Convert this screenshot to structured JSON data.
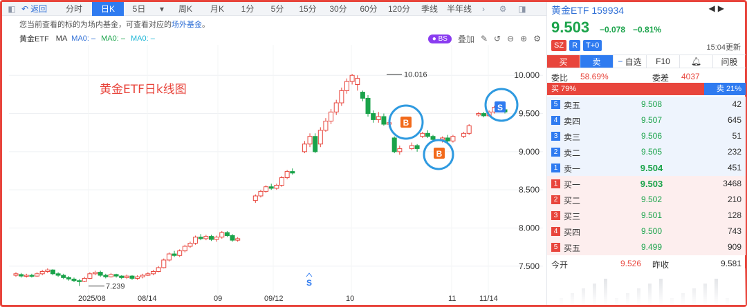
{
  "toolbar": {
    "back": "返回",
    "periods": [
      "分时",
      "日K",
      "5日",
      "周K",
      "月K",
      "1分",
      "5分",
      "15分",
      "30分",
      "60分",
      "120分",
      "季线",
      "半年线"
    ],
    "active": "日K"
  },
  "notice": {
    "text": "您当前查看的标的为场内基金，可查看对应的",
    "link": "场外基金",
    "end": "。"
  },
  "ma_bar": {
    "code": "黄金ETF",
    "ma": "MA",
    "ma0_1": "MA0: –",
    "ma0_2": "MA0: –",
    "ma0_3": "MA0: –",
    "bs": "BS",
    "overlay": "叠加"
  },
  "chart_data": {
    "type": "candlestick",
    "title": "黄金ETF日k线图",
    "y_ticks": [
      "10.000",
      "9.500",
      "9.000",
      "8.500",
      "8.000",
      "7.500"
    ],
    "ylim": [
      7.1,
      10.4
    ],
    "x_ticks": [
      "2025/08",
      "08/14",
      "09",
      "09/12",
      "10",
      "11",
      "11/14"
    ],
    "annotations": {
      "high": "10.016",
      "low": "7.239"
    },
    "markers": [
      "B",
      "B",
      "S",
      "S"
    ],
    "candles": [
      [
        7.38,
        7.4,
        7.36,
        7.42
      ],
      [
        7.39,
        7.37,
        7.35,
        7.41
      ],
      [
        7.37,
        7.38,
        7.35,
        7.4
      ],
      [
        7.38,
        7.37,
        7.35,
        7.4
      ],
      [
        7.37,
        7.4,
        7.36,
        7.42
      ],
      [
        7.4,
        7.43,
        7.38,
        7.45
      ],
      [
        7.43,
        7.45,
        7.41,
        7.47
      ],
      [
        7.45,
        7.4,
        7.38,
        7.46
      ],
      [
        7.4,
        7.38,
        7.36,
        7.42
      ],
      [
        7.38,
        7.35,
        7.33,
        7.4
      ],
      [
        7.35,
        7.33,
        7.31,
        7.37
      ],
      [
        7.33,
        7.31,
        7.29,
        7.35
      ],
      [
        7.31,
        7.3,
        7.24,
        7.33
      ],
      [
        7.3,
        7.34,
        7.29,
        7.36
      ],
      [
        7.34,
        7.4,
        7.33,
        7.42
      ],
      [
        7.4,
        7.42,
        7.38,
        7.44
      ],
      [
        7.42,
        7.38,
        7.36,
        7.44
      ],
      [
        7.38,
        7.36,
        7.34,
        7.4
      ],
      [
        7.36,
        7.39,
        7.35,
        7.41
      ],
      [
        7.39,
        7.37,
        7.35,
        7.4
      ],
      [
        7.37,
        7.35,
        7.33,
        7.38
      ],
      [
        7.35,
        7.37,
        7.33,
        7.39
      ],
      [
        7.37,
        7.34,
        7.32,
        7.38
      ],
      [
        7.34,
        7.36,
        7.32,
        7.38
      ],
      [
        7.36,
        7.38,
        7.34,
        7.4
      ],
      [
        7.38,
        7.4,
        7.37,
        7.42
      ],
      [
        7.4,
        7.43,
        7.38,
        7.45
      ],
      [
        7.43,
        7.48,
        7.42,
        7.5
      ],
      [
        7.48,
        7.58,
        7.47,
        7.6
      ],
      [
        7.58,
        7.66,
        7.56,
        7.68
      ],
      [
        7.66,
        7.64,
        7.62,
        7.7
      ],
      [
        7.64,
        7.7,
        7.62,
        7.72
      ],
      [
        7.7,
        7.76,
        7.68,
        7.78
      ],
      [
        7.76,
        7.8,
        7.74,
        7.82
      ],
      [
        7.8,
        7.88,
        7.78,
        7.9
      ],
      [
        7.88,
        7.86,
        7.84,
        7.92
      ],
      [
        7.86,
        7.89,
        7.84,
        7.91
      ],
      [
        7.89,
        7.85,
        7.83,
        7.91
      ],
      [
        7.85,
        7.88,
        7.82,
        7.9
      ],
      [
        7.88,
        7.94,
        7.86,
        7.96
      ],
      [
        7.94,
        7.9,
        7.88,
        7.96
      ],
      [
        7.9,
        7.84,
        7.82,
        7.92
      ],
      [
        7.84,
        7.86,
        7.82,
        7.88
      ],
      [
        8.36,
        8.42,
        8.33,
        8.44
      ],
      [
        8.42,
        8.48,
        8.4,
        8.5
      ],
      [
        8.48,
        8.54,
        8.46,
        8.56
      ],
      [
        8.54,
        8.52,
        8.5,
        8.58
      ],
      [
        8.52,
        8.56,
        8.5,
        8.58
      ],
      [
        8.56,
        8.66,
        8.54,
        8.68
      ],
      [
        8.66,
        8.74,
        8.64,
        8.76
      ],
      [
        8.74,
        8.72,
        8.7,
        8.78
      ],
      [
        9.0,
        9.1,
        8.98,
        9.14
      ],
      [
        9.1,
        9.2,
        9.06,
        9.24
      ],
      [
        9.2,
        9.0,
        8.98,
        9.24
      ],
      [
        9.1,
        9.28,
        9.06,
        9.32
      ],
      [
        9.28,
        9.4,
        9.26,
        9.44
      ],
      [
        9.4,
        9.52,
        9.36,
        9.56
      ],
      [
        9.52,
        9.64,
        9.48,
        9.68
      ],
      [
        9.64,
        9.8,
        9.6,
        9.84
      ],
      [
        9.8,
        9.92,
        9.76,
        9.96
      ],
      [
        9.92,
        10.0,
        9.88,
        10.02
      ],
      [
        9.88,
        9.96,
        9.8,
        10.0
      ],
      [
        9.78,
        9.7,
        9.66,
        9.8
      ],
      [
        9.7,
        9.5,
        9.46,
        9.74
      ],
      [
        9.5,
        9.42,
        9.38,
        9.54
      ],
      [
        9.42,
        9.46,
        9.38,
        9.52
      ],
      [
        9.46,
        9.36,
        9.34,
        9.5
      ],
      [
        9.36,
        9.38,
        9.32,
        9.42
      ],
      [
        9.18,
        9.0,
        8.98,
        9.2
      ],
      [
        9.0,
        9.04,
        8.96,
        9.08
      ],
      [
        9.04,
        9.08,
        9.02,
        9.12
      ],
      [
        9.08,
        9.04,
        9.0,
        9.1
      ],
      [
        9.2,
        9.24,
        9.18,
        9.26
      ],
      [
        9.24,
        9.2,
        9.18,
        9.28
      ],
      [
        9.2,
        9.16,
        9.14,
        9.22
      ],
      [
        9.16,
        9.18,
        9.12,
        9.2
      ],
      [
        9.18,
        9.14,
        9.12,
        9.22
      ],
      [
        9.14,
        9.2,
        9.12,
        9.22
      ],
      [
        9.2,
        9.24,
        9.18,
        9.26
      ],
      [
        9.24,
        9.34,
        9.22,
        9.36
      ],
      [
        9.48,
        9.5,
        9.46,
        9.52
      ],
      [
        9.5,
        9.47,
        9.45,
        9.52
      ],
      [
        9.47,
        9.52,
        9.46,
        9.54
      ],
      [
        9.52,
        9.58,
        9.5,
        9.6
      ],
      [
        9.58,
        9.55,
        9.52,
        9.61
      ],
      [
        9.55,
        9.52,
        9.5,
        9.57
      ]
    ]
  },
  "quote": {
    "name": "黄金ETF",
    "code": "159934",
    "price": "9.503",
    "change": "−0.078",
    "change_pct": "−0.81%",
    "badges": [
      "SZ",
      "R",
      "T+0"
    ],
    "update_time": "15:04更新",
    "tabs": [
      "买",
      "卖",
      "自选",
      "F10",
      "问股"
    ],
    "weibi_label": "委比",
    "weibi": "58.69%",
    "weicha_label": "委差",
    "weicha": "4037",
    "buy_ratio": "买 79%",
    "sell_ratio": "卖 21%",
    "buy_pct": 0.79,
    "asks": [
      {
        "idx": "5",
        "label": "卖五",
        "price": "9.508",
        "qty": "42"
      },
      {
        "idx": "4",
        "label": "卖四",
        "price": "9.507",
        "qty": "645"
      },
      {
        "idx": "3",
        "label": "卖三",
        "price": "9.506",
        "qty": "51"
      },
      {
        "idx": "2",
        "label": "卖二",
        "price": "9.505",
        "qty": "232"
      },
      {
        "idx": "1",
        "label": "卖一",
        "price": "9.504",
        "qty": "451"
      }
    ],
    "bids": [
      {
        "idx": "1",
        "label": "买一",
        "price": "9.503",
        "qty": "3468"
      },
      {
        "idx": "2",
        "label": "买二",
        "price": "9.502",
        "qty": "210"
      },
      {
        "idx": "3",
        "label": "买三",
        "price": "9.501",
        "qty": "128"
      },
      {
        "idx": "4",
        "label": "买四",
        "price": "9.500",
        "qty": "743"
      },
      {
        "idx": "5",
        "label": "买五",
        "price": "9.499",
        "qty": "909"
      }
    ],
    "open_label": "今开",
    "open": "9.526",
    "prev_label": "昨收",
    "prev": "9.581"
  },
  "colors": {
    "up": "#e8453c",
    "down": "#1aa34a",
    "accent": "#2f7bf0",
    "marker_b": "#f26a1b",
    "marker_s": "#2f7bf0"
  }
}
